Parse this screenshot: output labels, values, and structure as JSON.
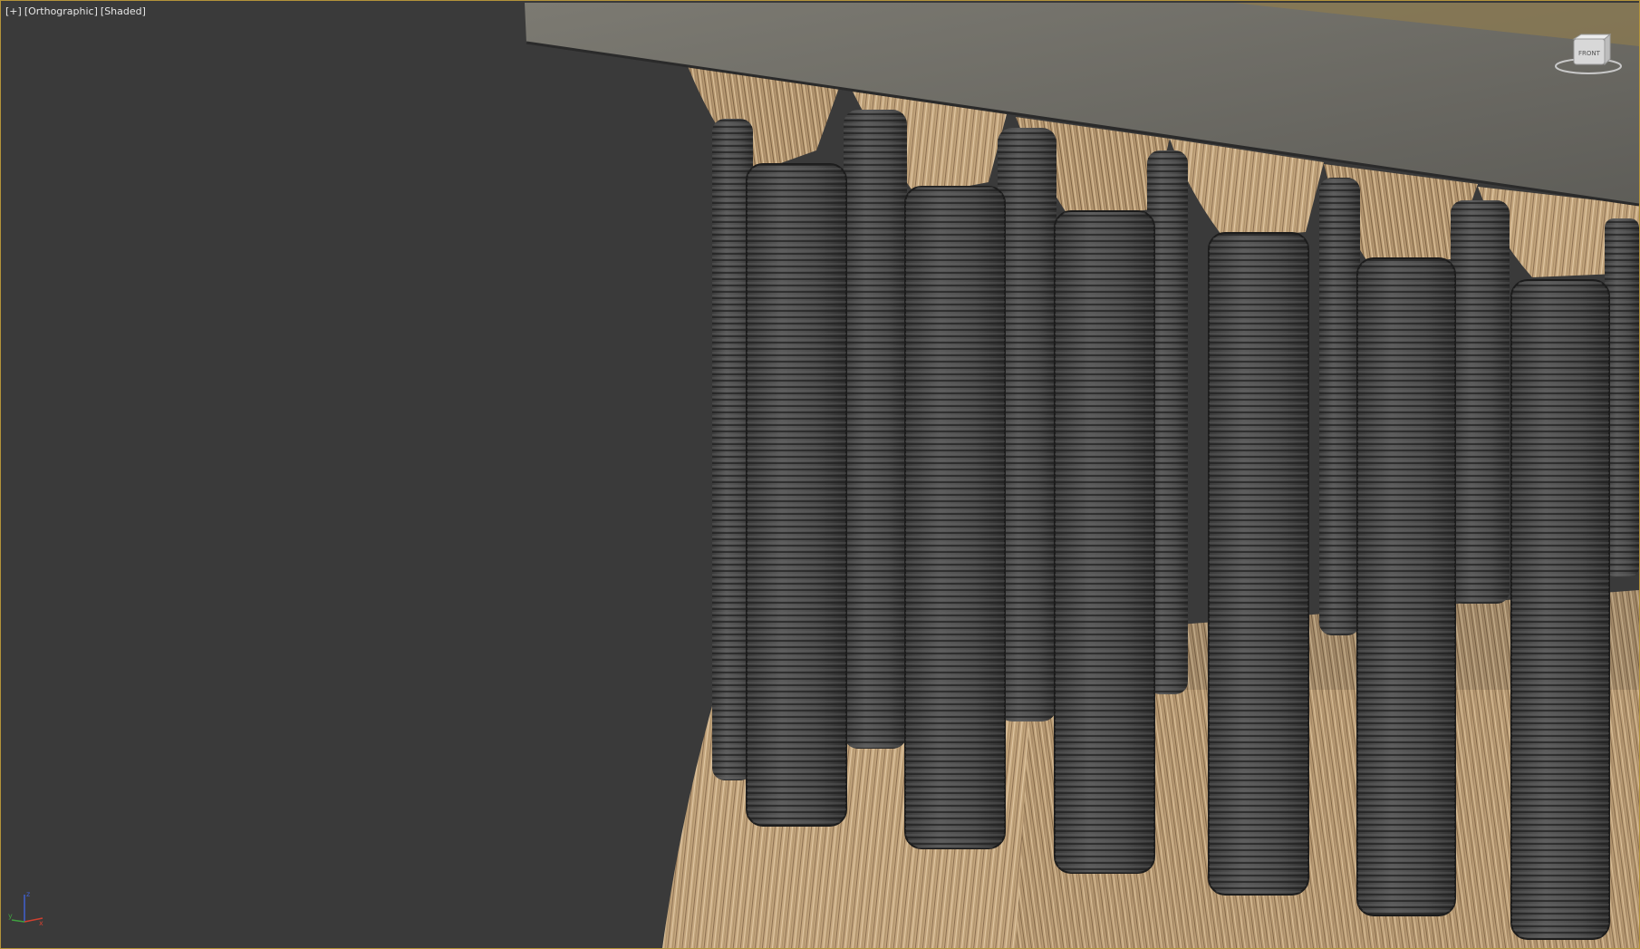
{
  "viewport": {
    "label_plus": "[+]",
    "label_view": "[Orthographic]",
    "label_shading": "[Shaded]",
    "border_color": "#b3933a",
    "background_color": "#3a3a3a"
  },
  "viewcube": {
    "icon": "viewcube-icon",
    "face_label": "FRONT"
  },
  "axis_gizmo": {
    "icon": "xyz-axis-icon",
    "x_label": "x",
    "y_label": "y",
    "z_label": "z",
    "x_color": "#d04030",
    "y_color": "#40a040",
    "z_color": "#4060d0"
  },
  "scene": {
    "description_icon": "tassel-fringe-model-icon",
    "band_color": "#2e2e2e",
    "fiber_color": "#c9ad86",
    "plank_color": "#6b6a65"
  }
}
